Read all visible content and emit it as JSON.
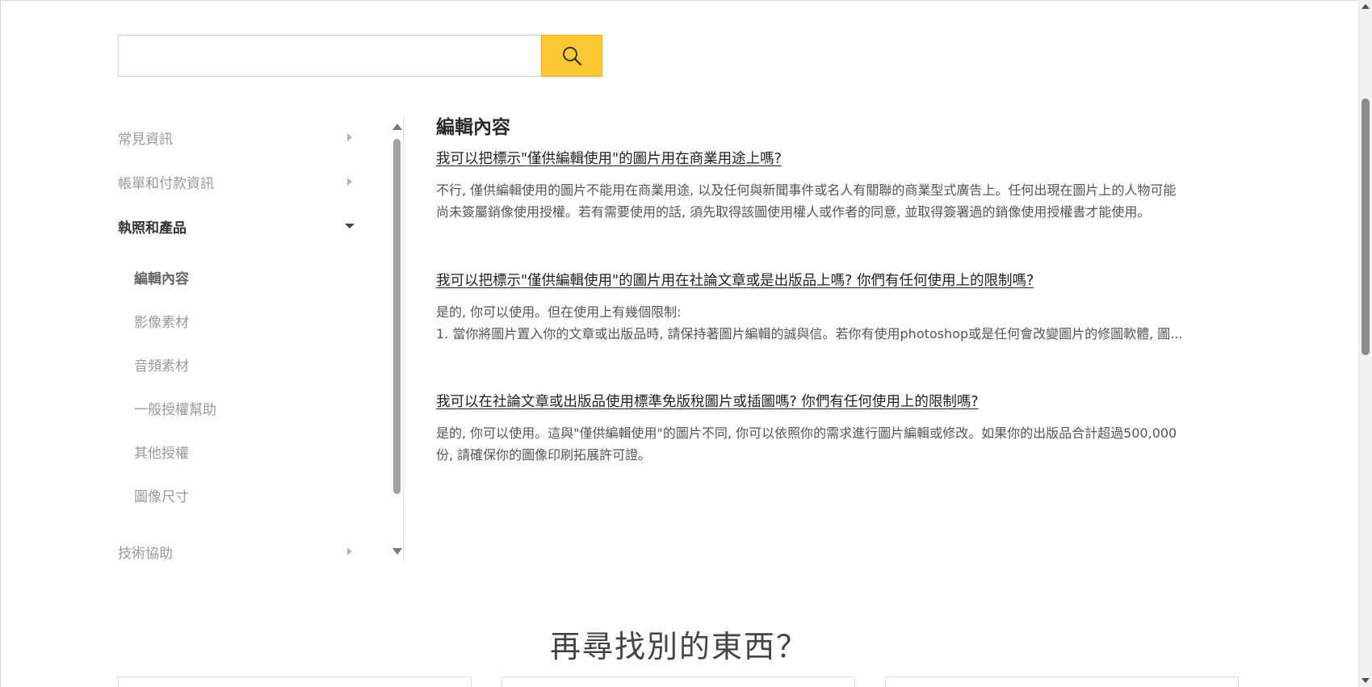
{
  "search": {
    "placeholder": "",
    "value": "",
    "button_icon": "search-icon",
    "button_color": "#fdc833"
  },
  "sidebar": {
    "categories": [
      {
        "label": "常見資訊",
        "expanded": false
      },
      {
        "label": "帳單和付款資訊",
        "expanded": false
      },
      {
        "label": "執照和產品",
        "expanded": true
      },
      {
        "label": "技術協助",
        "expanded": false
      }
    ],
    "sub_items": [
      {
        "label": "編輯內容",
        "active": true
      },
      {
        "label": "影像素材"
      },
      {
        "label": "音頻素材"
      },
      {
        "label": "一般授權幫助"
      },
      {
        "label": "其他授權"
      },
      {
        "label": "圖像尺寸"
      }
    ]
  },
  "main": {
    "section_title": "編輯內容",
    "qa": [
      {
        "question": "我可以把標示\"僅供編輯使用\"的圖片用在商業用途上嗎?",
        "answer_lines": [
          "不行, 僅供編輯使用的圖片不能用在商業用途, 以及任何與新聞事件或名人有關聯的商業型式廣告上。任何出現在圖片上的人物可能",
          "尚未簽屬銷像使用授權。若有需要使用的話, 須先取得該圖使用權人或作者的同意, 並取得簽署過的銷像使用授權書才能使用。"
        ]
      },
      {
        "question": "我可以把標示\"僅供編輯使用\"的圖片用在社論文章或是出版品上嗎? 你們有任何使用上的限制嗎?",
        "answer_lines": [
          "是的, 你可以使用。但在使用上有幾個限制:",
          "1. 當你將圖片置入你的文章或出版品時, 請保持著圖片編輯的誠與信。若你有使用photoshop或是任何會改變圖片的修圖軟體, 圖..."
        ]
      },
      {
        "question": "我可以在社論文章或出版品使用標準免版稅圖片或插圖嗎? 你們有任何使用上的限制嗎?",
        "answer_lines": [
          "是的, 你可以使用。這與\"僅供編輯使用\"的圖片不同, 你可以依照你的需求進行圖片編輯或修改。如果你的出版品合計超過500,000",
          "份, 請確保你的圖像印刷拓展許可證。"
        ]
      }
    ]
  },
  "footer": {
    "more_heading": "再尋找別的東西？"
  }
}
